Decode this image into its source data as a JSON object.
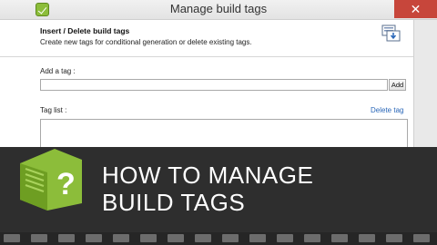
{
  "window": {
    "title": "Manage build tags",
    "close_glyph": "✕"
  },
  "header": {
    "title": "Insert / Delete build tags",
    "description": "Create new tags for conditional generation or delete existing tags.",
    "icon": "document-tag-icon"
  },
  "add_tag": {
    "label": "Add a tag :",
    "value": "",
    "button_label": "Add"
  },
  "tag_list": {
    "label": "Tag list :",
    "delete_link": "Delete tag",
    "items": []
  },
  "banner": {
    "line1": "HOW TO MANAGE",
    "line2": "BUILD TAGS",
    "logo_icon": "help-book-icon"
  },
  "colors": {
    "accent_link": "#2a67b8",
    "close_button": "#c7463b",
    "logo_green": "#8cbd3a",
    "banner_bg": "#2e2e2e"
  }
}
